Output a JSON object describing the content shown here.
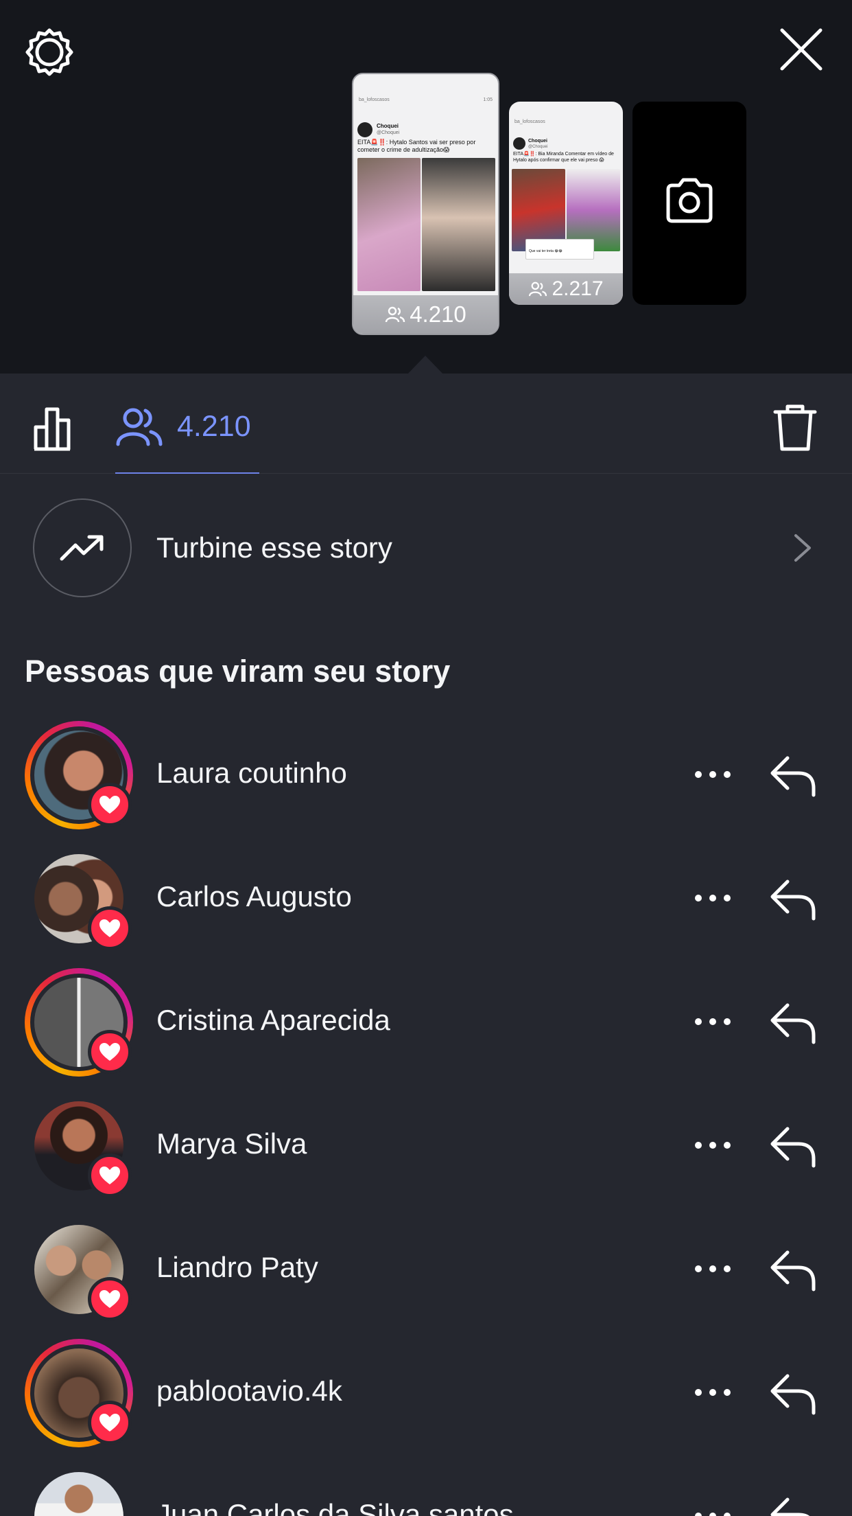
{
  "top_bar": {
    "settings_icon": "gear-icon",
    "close_icon": "close-icon"
  },
  "stories": [
    {
      "viewer_count": "4.210",
      "preview": {
        "account": "ba_lofoscasos",
        "time": "1:05",
        "handle": "Choquei",
        "subhandle": "@Choquei",
        "text": "EITA🚨‼️: Hytalo Santos vai ser preso por cometer o crime de adultização😱"
      }
    },
    {
      "viewer_count": "2.217",
      "preview": {
        "account": "ba_lofoscasos",
        "handle": "Choquei",
        "subhandle": "@Choquei",
        "text": "EITA🚨‼️: Bia Miranda Comentar em vídeo de Hytalo após confirmar que ele vai preso 😱",
        "comment": "Que vai ter treta 😂😂"
      }
    },
    {
      "type": "camera",
      "icon": "camera-icon"
    }
  ],
  "tabs": {
    "insights_icon": "bar-chart-icon",
    "viewers_icon": "people-icon",
    "viewers_count": "4.210",
    "delete_icon": "trash-icon"
  },
  "boost": {
    "label": "Turbine esse story",
    "icon": "trending-up-icon"
  },
  "section_title": "Pessoas que viram seu story",
  "viewers": [
    {
      "name": "Laura coutinho",
      "ring": true,
      "liked": true
    },
    {
      "name": "Carlos Augusto",
      "ring": false,
      "liked": true
    },
    {
      "name": "Cristina Aparecida",
      "ring": true,
      "liked": true
    },
    {
      "name": "Marya Silva",
      "ring": false,
      "liked": true
    },
    {
      "name": "Liandro Paty",
      "ring": false,
      "liked": true
    },
    {
      "name": "pablootavio.4k",
      "ring": true,
      "liked": true
    },
    {
      "name": "Juan Carlos da Silva santos",
      "ring": false,
      "liked": false
    }
  ],
  "colors": {
    "background": "#25272f",
    "top_background": "#15171c",
    "accent": "#7b94ff",
    "heart": "#ff2b4a"
  }
}
